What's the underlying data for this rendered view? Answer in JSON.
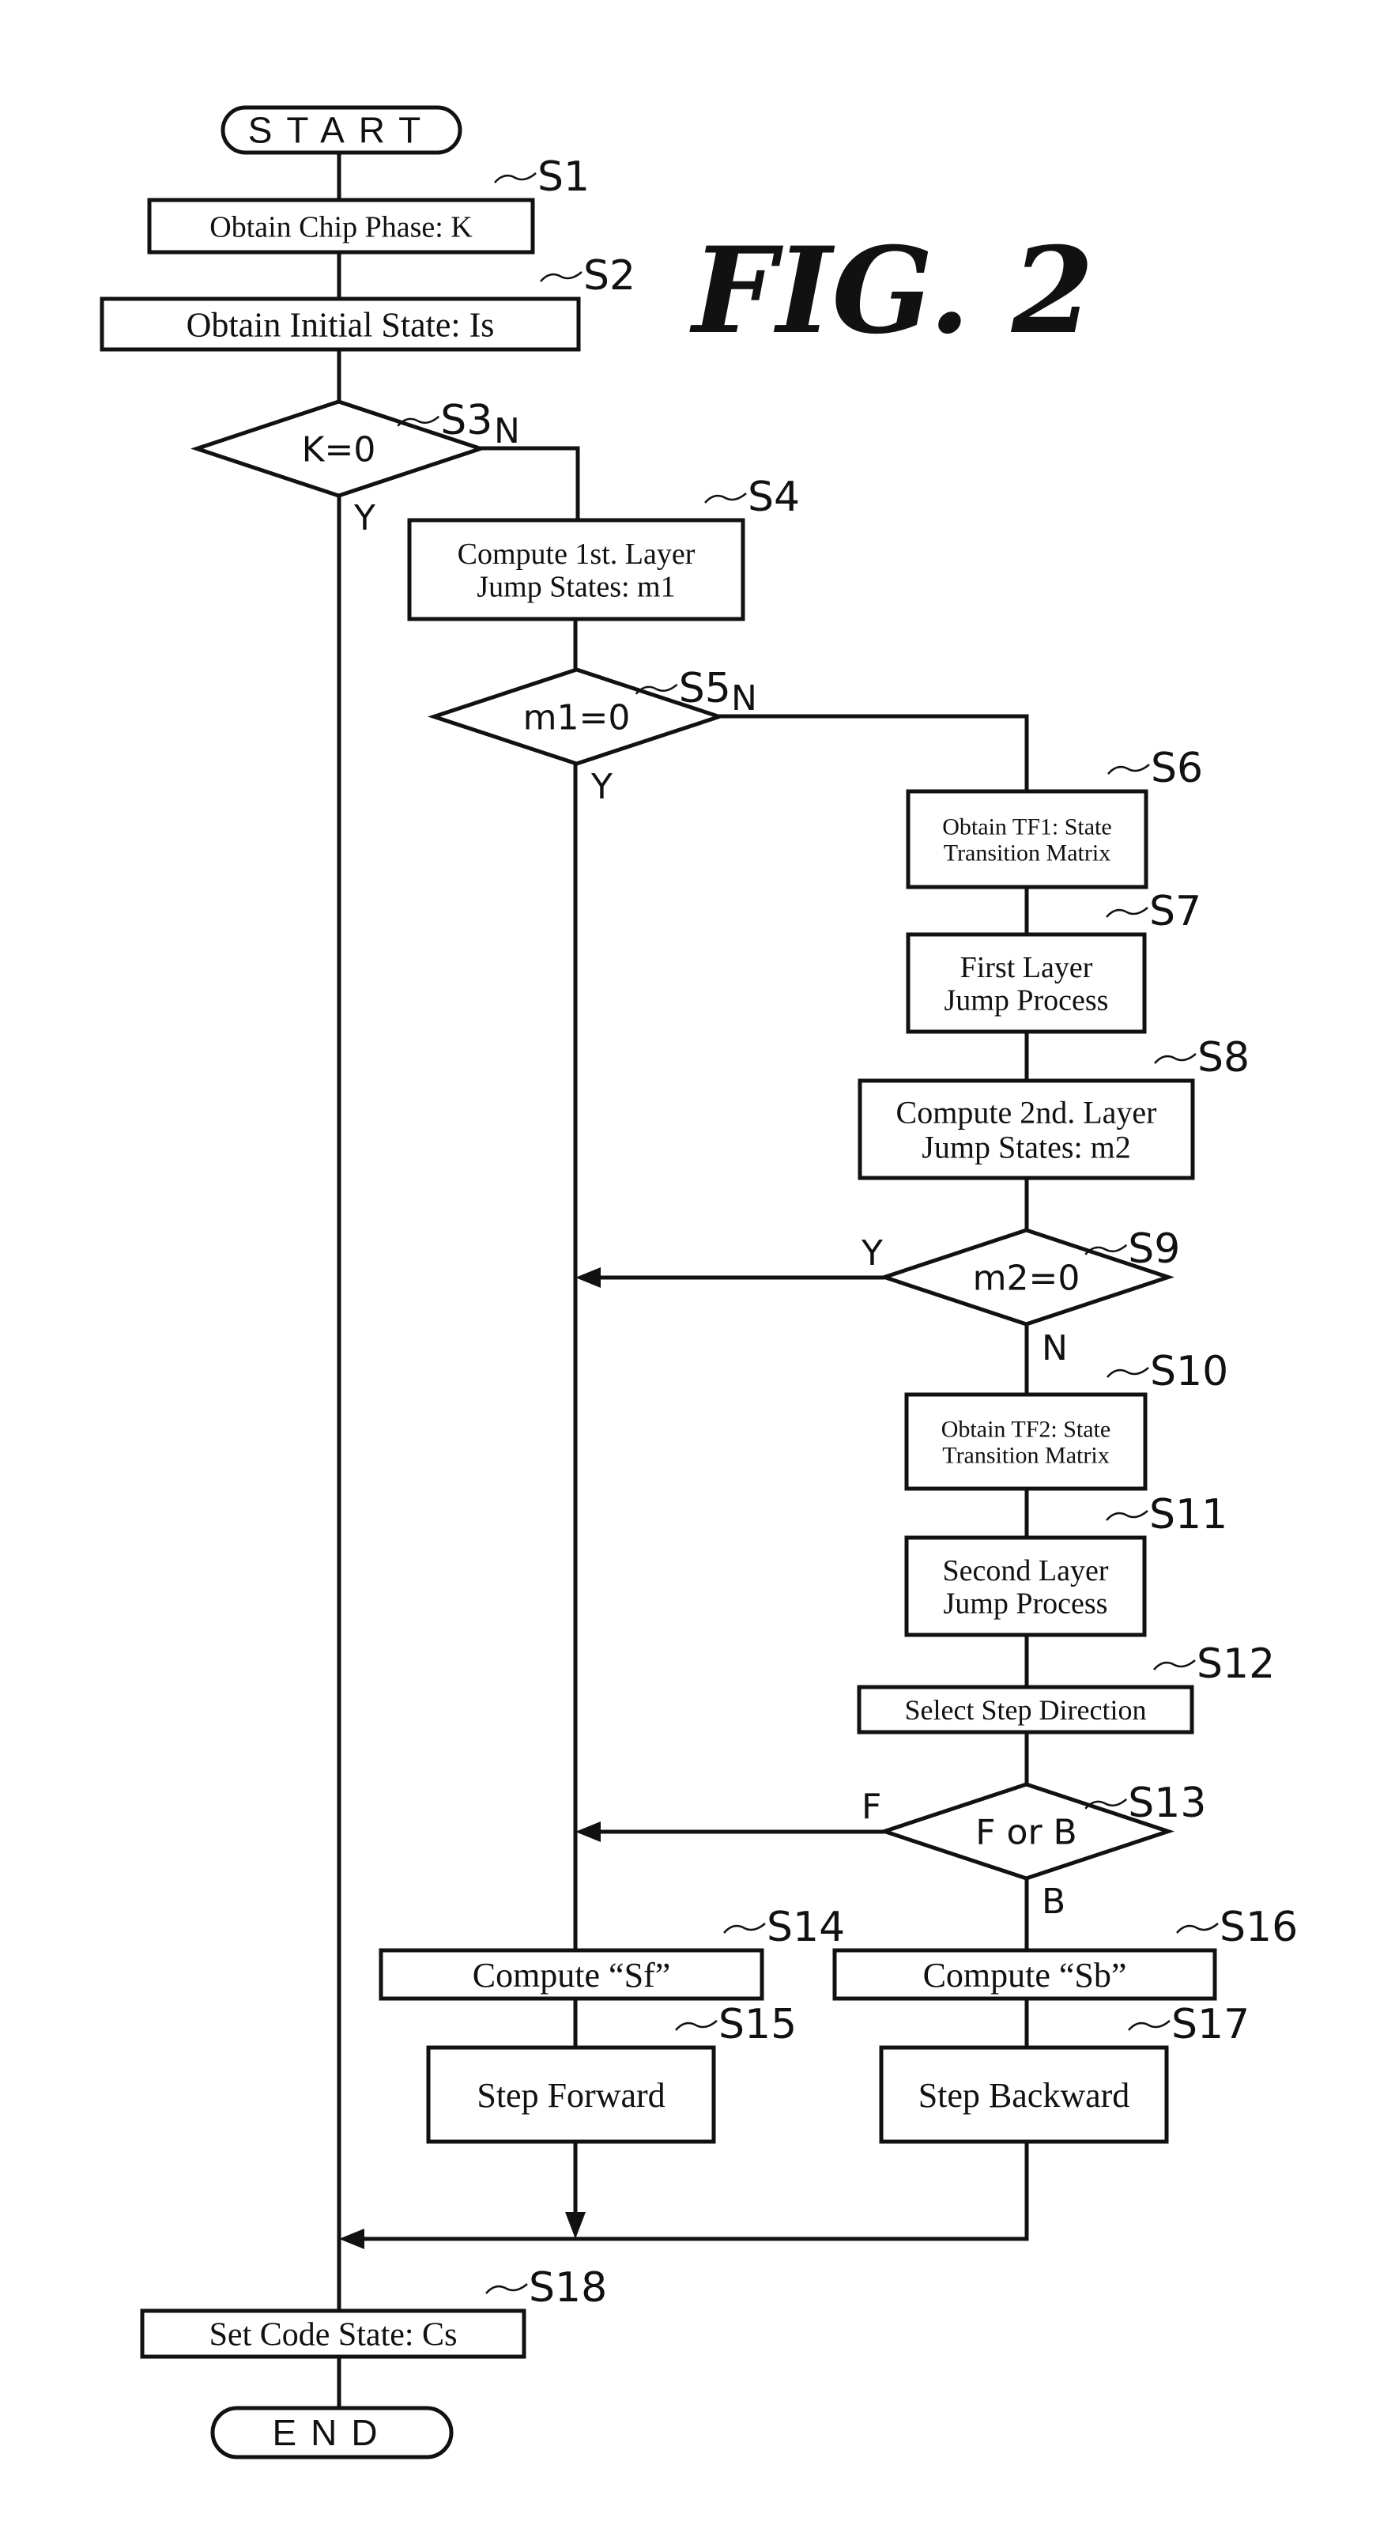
{
  "figure_title": "FIG. 2",
  "terminals": {
    "start": "START",
    "end": "END"
  },
  "steps": {
    "S1": {
      "label": "S1",
      "lines": [
        "Obtain Chip Phase: K"
      ]
    },
    "S2": {
      "label": "S2",
      "lines": [
        "Obtain Initial State: Is"
      ]
    },
    "S3": {
      "label": "S3",
      "lines": [
        "K=0"
      ],
      "yes": "Y",
      "no": "N"
    },
    "S4": {
      "label": "S4",
      "lines": [
        "Compute 1st. Layer",
        "Jump States: m1"
      ]
    },
    "S5": {
      "label": "S5",
      "lines": [
        "m1=0"
      ],
      "yes": "Y",
      "no": "N"
    },
    "S6": {
      "label": "S6",
      "lines": [
        "Obtain TF1: State",
        "Transition Matrix"
      ]
    },
    "S7": {
      "label": "S7",
      "lines": [
        "First Layer",
        "Jump Process"
      ]
    },
    "S8": {
      "label": "S8",
      "lines": [
        "Compute 2nd. Layer",
        "Jump States: m2"
      ]
    },
    "S9": {
      "label": "S9",
      "lines": [
        "m2=0"
      ],
      "yes": "Y",
      "no": "N"
    },
    "S10": {
      "label": "S10",
      "lines": [
        "Obtain TF2: State",
        "Transition Matrix"
      ]
    },
    "S11": {
      "label": "S11",
      "lines": [
        "Second Layer",
        "Jump Process"
      ]
    },
    "S12": {
      "label": "S12",
      "lines": [
        "Select Step Direction"
      ]
    },
    "S13": {
      "label": "S13",
      "lines": [
        "F or B"
      ],
      "forward": "F",
      "backward": "B"
    },
    "S14": {
      "label": "S14",
      "lines": [
        "Compute “Sf”"
      ]
    },
    "S15": {
      "label": "S15",
      "lines": [
        "Step Forward"
      ]
    },
    "S16": {
      "label": "S16",
      "lines": [
        "Compute “Sb”"
      ]
    },
    "S17": {
      "label": "S17",
      "lines": [
        "Step Backward"
      ]
    },
    "S18": {
      "label": "S18",
      "lines": [
        "Set Code State: Cs"
      ]
    }
  }
}
